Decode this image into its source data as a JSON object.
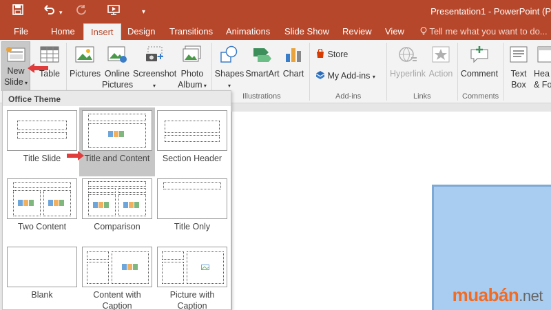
{
  "titlebar": {
    "title": "Presentation1 - PowerPoint (P",
    "save_icon": "save-icon",
    "undo_icon": "undo-icon",
    "redo_icon": "redo-icon",
    "present_icon": "present-from-start-icon",
    "customize_icon": "customize-qat-icon"
  },
  "tabs": {
    "file": "File",
    "home": "Home",
    "insert": "Insert",
    "design": "Design",
    "transitions": "Transitions",
    "animations": "Animations",
    "slideshow": "Slide Show",
    "review": "Review",
    "view": "View",
    "tellme": "Tell me what you want to do..."
  },
  "ribbon": {
    "new_slide": {
      "line1": "New",
      "line2": "Slide"
    },
    "table": "Table",
    "pictures": "Pictures",
    "online_pictures": {
      "line1": "Online",
      "line2": "Pictures"
    },
    "screenshot": "Screenshot",
    "photo_album": {
      "line1": "Photo",
      "line2": "Album"
    },
    "shapes": "Shapes",
    "smartart": "SmartArt",
    "chart": "Chart",
    "store": "Store",
    "my_addins": "My Add-ins",
    "hyperlink": "Hyperlink",
    "action": "Action",
    "comment": "Comment",
    "textbox": {
      "line1": "Text",
      "line2": "Box"
    },
    "header_footer": {
      "line1": "Hea",
      "line2": "& Fo"
    },
    "groups": {
      "illustrations": "Illustrations",
      "addins": "Add-ins",
      "links": "Links",
      "comments": "Comments"
    }
  },
  "gallery": {
    "header": "Office Theme",
    "layouts": [
      {
        "name": "Title Slide"
      },
      {
        "name": "Title and Content"
      },
      {
        "name": "Section Header"
      },
      {
        "name": "Two Content"
      },
      {
        "name": "Comparison"
      },
      {
        "name": "Title Only"
      },
      {
        "name": "Blank"
      },
      {
        "name": "Content with Caption"
      },
      {
        "name": "Picture with Caption"
      }
    ]
  },
  "watermark": {
    "brand": "muabán",
    "tld": ".net"
  },
  "colors": {
    "accent": "#b7472a",
    "arrow": "#e03c3c",
    "placeholder": "#a9cdf1",
    "watermark": "#f26b23"
  }
}
